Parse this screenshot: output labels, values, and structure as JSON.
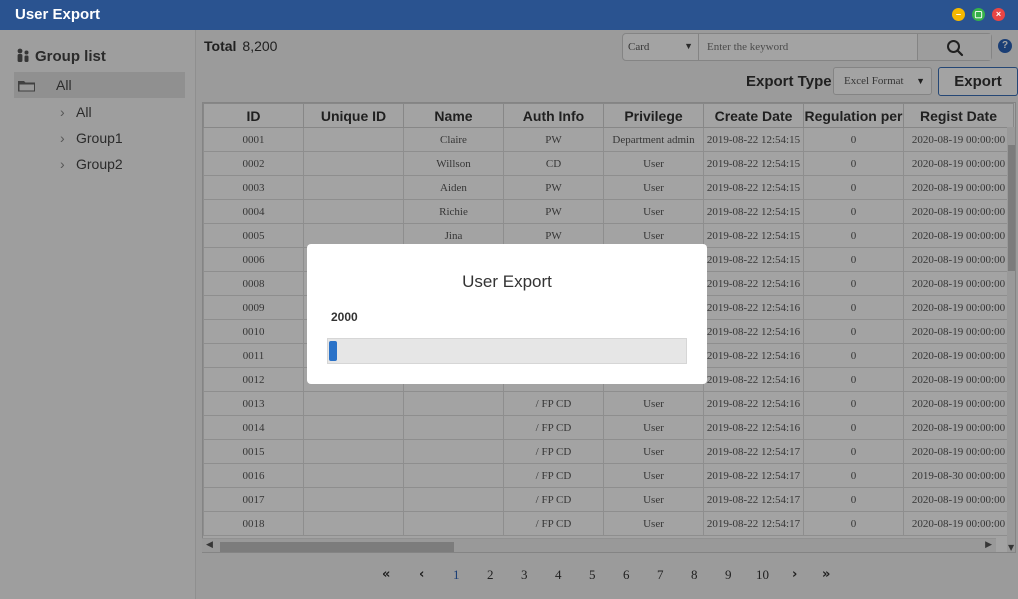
{
  "window": {
    "title": "User Export"
  },
  "sidebar": {
    "title": "Group list",
    "root": "All",
    "items": [
      {
        "label": "All"
      },
      {
        "label": "Group1"
      },
      {
        "label": "Group2"
      }
    ]
  },
  "toolbar": {
    "total_label": "Total",
    "total_value": "8,200",
    "search_field": "Card",
    "search_placeholder": "Enter the keyword",
    "help": "?",
    "export_type_label": "Export Type",
    "export_format": "Excel Format",
    "export_button": "Export"
  },
  "table": {
    "columns": [
      "ID",
      "Unique ID",
      "Name",
      "Auth Info",
      "Privilege",
      "Create Date",
      "Regulation per",
      "Regist Date"
    ],
    "rows": [
      [
        "0001",
        "",
        "Claire",
        "PW",
        "Department admin",
        "2019-08-22 12:54:15",
        "0",
        "2020-08-19 00:00:00"
      ],
      [
        "0002",
        "",
        "Willson",
        "CD",
        "User",
        "2019-08-22 12:54:15",
        "0",
        "2020-08-19 00:00:00"
      ],
      [
        "0003",
        "",
        "Aiden",
        "PW",
        "User",
        "2019-08-22 12:54:15",
        "0",
        "2020-08-19 00:00:00"
      ],
      [
        "0004",
        "",
        "Richie",
        "PW",
        "User",
        "2019-08-22 12:54:15",
        "0",
        "2020-08-19 00:00:00"
      ],
      [
        "0005",
        "",
        "Jina",
        "PW",
        "User",
        "2019-08-22 12:54:15",
        "0",
        "2020-08-19 00:00:00"
      ],
      [
        "0006",
        "",
        "",
        "",
        "",
        "2019-08-22 12:54:15",
        "0",
        "2020-08-19 00:00:00"
      ],
      [
        "0008",
        "",
        "",
        "",
        "",
        "2019-08-22 12:54:16",
        "0",
        "2020-08-19 00:00:00"
      ],
      [
        "0009",
        "",
        "",
        "",
        "",
        "2019-08-22 12:54:16",
        "0",
        "2020-08-19 00:00:00"
      ],
      [
        "0010",
        "",
        "",
        "",
        "",
        "2019-08-22 12:54:16",
        "0",
        "2020-08-19 00:00:00"
      ],
      [
        "0011",
        "",
        "",
        "",
        "",
        "2019-08-22 12:54:16",
        "0",
        "2020-08-19 00:00:00"
      ],
      [
        "0012",
        "",
        "",
        "",
        "",
        "2019-08-22 12:54:16",
        "0",
        "2020-08-19 00:00:00"
      ],
      [
        "0013",
        "",
        "",
        "/ FP CD",
        "User",
        "2019-08-22 12:54:16",
        "0",
        "2020-08-19 00:00:00"
      ],
      [
        "0014",
        "",
        "",
        "/ FP CD",
        "User",
        "2019-08-22 12:54:16",
        "0",
        "2020-08-19 00:00:00"
      ],
      [
        "0015",
        "",
        "",
        "/ FP CD",
        "User",
        "2019-08-22 12:54:17",
        "0",
        "2020-08-19 00:00:00"
      ],
      [
        "0016",
        "",
        "",
        "/ FP CD",
        "User",
        "2019-08-22 12:54:17",
        "0",
        "2019-08-30 00:00:00"
      ],
      [
        "0017",
        "",
        "",
        "/ FP CD",
        "User",
        "2019-08-22 12:54:17",
        "0",
        "2020-08-19 00:00:00"
      ],
      [
        "0018",
        "",
        "",
        "/ FP CD",
        "User",
        "2019-08-22 12:54:17",
        "0",
        "2020-08-19 00:00:00"
      ]
    ]
  },
  "pagination": {
    "first": "«",
    "prev": "‹",
    "pages": [
      "1",
      "2",
      "3",
      "4",
      "5",
      "6",
      "7",
      "8",
      "9",
      "10"
    ],
    "active_page": "1",
    "next": "›",
    "last": "»"
  },
  "modal": {
    "title": "User Export",
    "count": "2000",
    "progress": 0.02
  },
  "colors": {
    "titlebar": "#2a5390",
    "accent": "#2a72c8",
    "minimize": "#f5b800",
    "maximize": "#36b24a",
    "close": "#e84545"
  }
}
